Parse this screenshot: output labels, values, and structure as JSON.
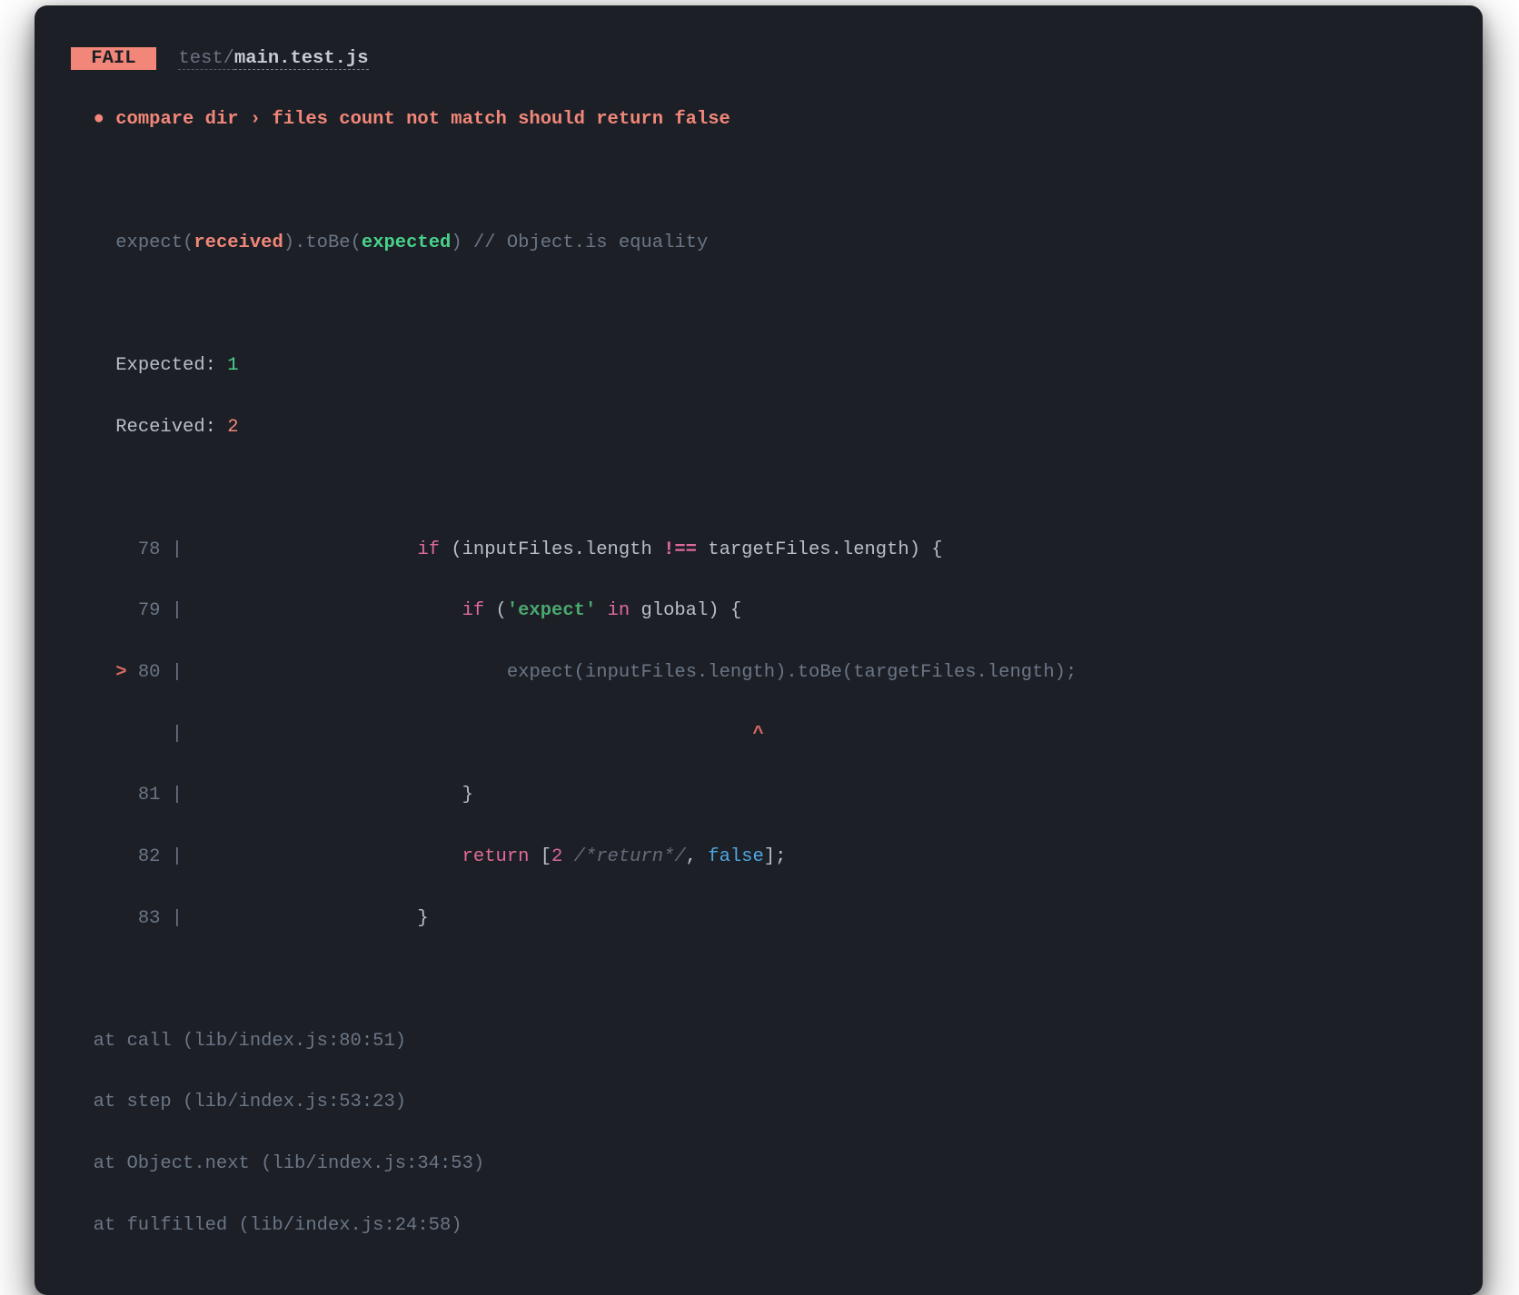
{
  "header": {
    "fail_label": " FAIL ",
    "file_dir": "test/",
    "file_name": "main.test.js"
  },
  "test": {
    "bullet": "●",
    "title": "compare dir › files count not match should return false"
  },
  "matcher": {
    "expect_open": "expect(",
    "received": "received",
    "close_to": ").",
    "toBe": "toBe",
    "paren_open": "(",
    "expected": "expected",
    "paren_close": ")",
    "comment": " // Object.is equality"
  },
  "summary": {
    "expected_label": "Expected: ",
    "expected_value": "1",
    "received_label": "Received: ",
    "received_value": "2"
  },
  "code": {
    "lines": {
      "l78": {
        "num": "78",
        "indent": "                    ",
        "if_kw": "if",
        "cond": " (inputFiles.length ",
        "neq": "!==",
        "cond2": " targetFiles.length) {"
      },
      "l79": {
        "num": "79",
        "indent": "                        ",
        "if_kw": "if",
        "paren": " (",
        "str": "'expect'",
        "in_kw": " in ",
        "rest": "global) {"
      },
      "l80": {
        "arrow": ">",
        "num": "80",
        "indent": "                            ",
        "call": "expect(inputFiles.length).toBe(targetFiles.length);"
      },
      "lcaret": {
        "indent": "                                                  ",
        "caret": "^"
      },
      "l81": {
        "num": "81",
        "indent": "                        ",
        "brace": "}"
      },
      "l82": {
        "num": "82",
        "indent": "                        ",
        "ret_kw": "return",
        "sp": " [",
        "two": "2",
        "comment": " /*return*/",
        "comma": ", ",
        "false_v": "false",
        "close": "];"
      },
      "l83": {
        "num": "83",
        "indent": "                    ",
        "brace": "}"
      }
    }
  },
  "stack": {
    "s0": "  at call (lib/index.js:80:51)",
    "s1": "  at step (lib/index.js:53:23)",
    "s2": "  at Object.next (lib/index.js:34:53)",
    "s3": "  at fulfilled (lib/index.js:24:58)"
  }
}
